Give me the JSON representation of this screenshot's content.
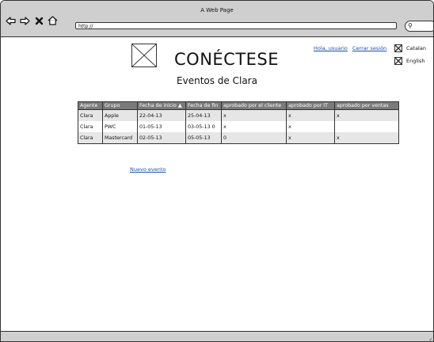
{
  "window": {
    "title": "A Web Page"
  },
  "toolbar": {
    "back_icon": "back-arrow-icon",
    "forward_icon": "forward-arrow-icon",
    "close_icon": "close-icon",
    "home_icon": "home-icon",
    "address": "http://",
    "search_icon": "search-icon"
  },
  "header": {
    "title": "CONÉCTESE",
    "subtitle": "Eventos de Clara",
    "greeting_link": "Hola, usuario",
    "logout_link": "Cerrar sesión",
    "languages": [
      "Catalan",
      "English"
    ]
  },
  "table": {
    "columns": [
      "Agente",
      "Grupo",
      "Fecha de inicio ▲",
      "Fecha de fin",
      "aprobado por el cliente",
      "aprobado por IT",
      "aprobado por ventas"
    ],
    "rows": [
      [
        "Clara",
        "Apple",
        "22-04-13",
        "25-04-13",
        "x",
        "x",
        "x"
      ],
      [
        "Clara",
        "PWC",
        "01-05-13",
        "03-05-13 0",
        "x",
        "x",
        ""
      ],
      [
        "Clara",
        "Mastercard",
        "02-05-13",
        "05-05-13",
        "0",
        "x",
        "x"
      ]
    ]
  },
  "actions": {
    "new_event_link": "Nuevo evento"
  },
  "colors": {
    "link": "#1a4fb0",
    "header_bg": "#7a7a7a",
    "chrome_bg": "#cfcfcf"
  }
}
